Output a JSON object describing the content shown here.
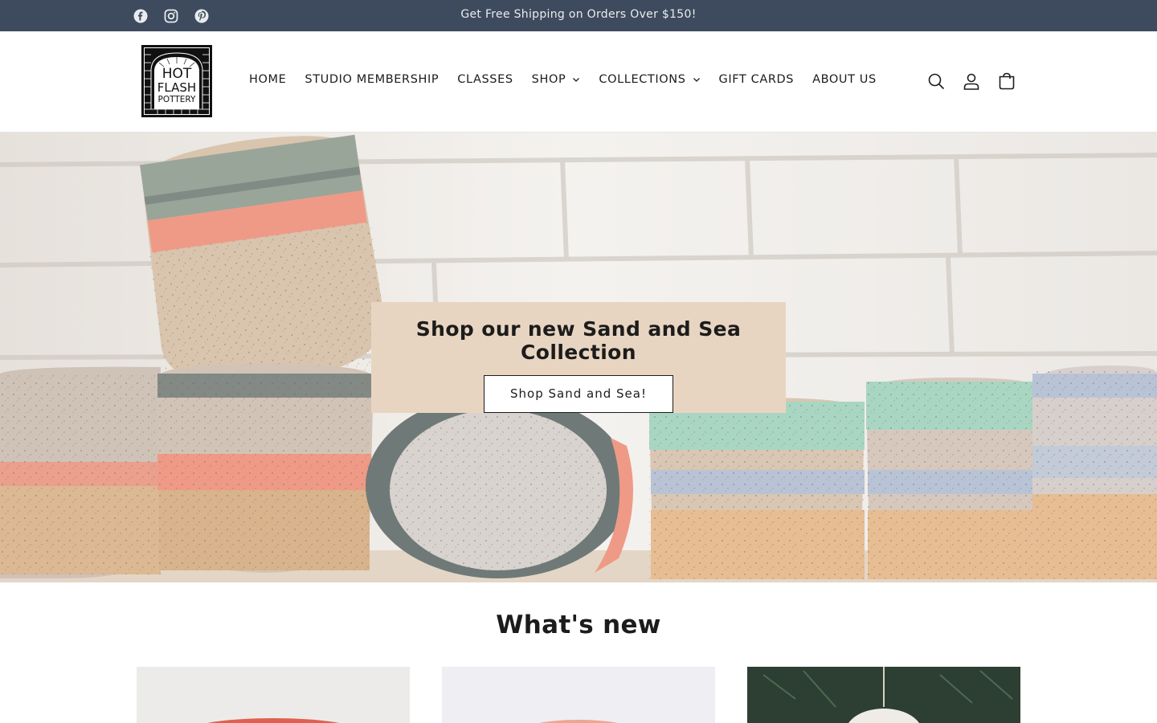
{
  "announcement": {
    "text": "Get Free Shipping on Orders Over $150!"
  },
  "social": [
    {
      "name": "facebook-icon"
    },
    {
      "name": "instagram-icon"
    },
    {
      "name": "pinterest-icon"
    }
  ],
  "brand": {
    "line1": "HOT",
    "line2": "FLASH",
    "line3": "POTTERY"
  },
  "nav": {
    "home": "HOME",
    "studio": "STUDIO MEMBERSHIP",
    "classes": "CLASSES",
    "shop": "SHOP",
    "collections": "COLLECTIONS",
    "gift": "GIFT CARDS",
    "about": "ABOUT US"
  },
  "hero": {
    "title": "Shop our new Sand and Sea Collection",
    "button": "Shop Sand and Sea!"
  },
  "section": {
    "title": "What's new"
  },
  "colors": {
    "announce_bg": "#3e4b5e",
    "hero_box": "#e8d5c1",
    "text": "#1c1c1c"
  }
}
